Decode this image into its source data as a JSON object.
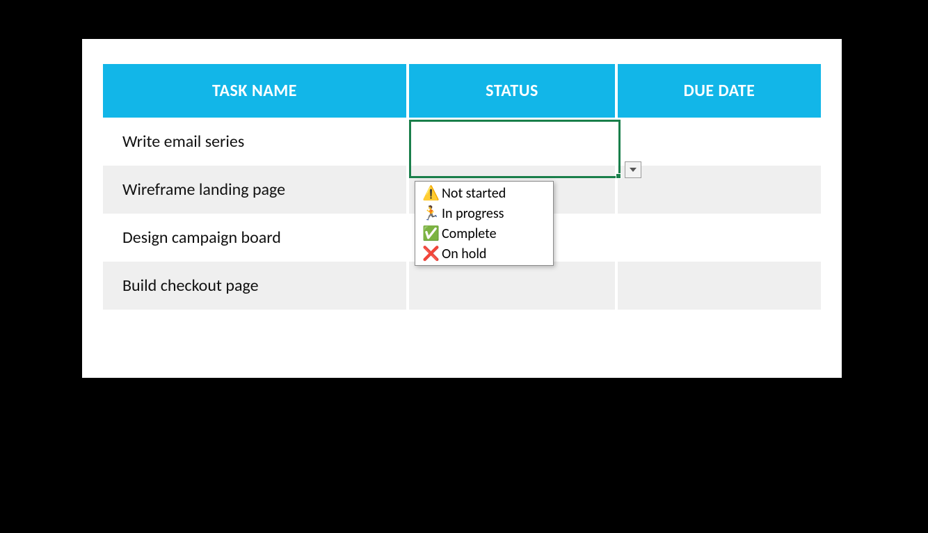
{
  "columns": {
    "task": "TASK NAME",
    "status": "STATUS",
    "due": "DUE DATE"
  },
  "rows": [
    {
      "task": "Write email series",
      "status": "",
      "due": ""
    },
    {
      "task": "Wireframe landing page",
      "status": "",
      "due": ""
    },
    {
      "task": "Design campaign board",
      "status": "",
      "due": ""
    },
    {
      "task": "Build checkout page",
      "status": "",
      "due": ""
    }
  ],
  "dropdown": {
    "options": [
      {
        "icon": "⚠️",
        "label": "Not started"
      },
      {
        "icon": "🏃",
        "label": "In progress"
      },
      {
        "icon": "✅",
        "label": "Complete"
      },
      {
        "icon": "❌",
        "label": "On hold"
      }
    ]
  }
}
